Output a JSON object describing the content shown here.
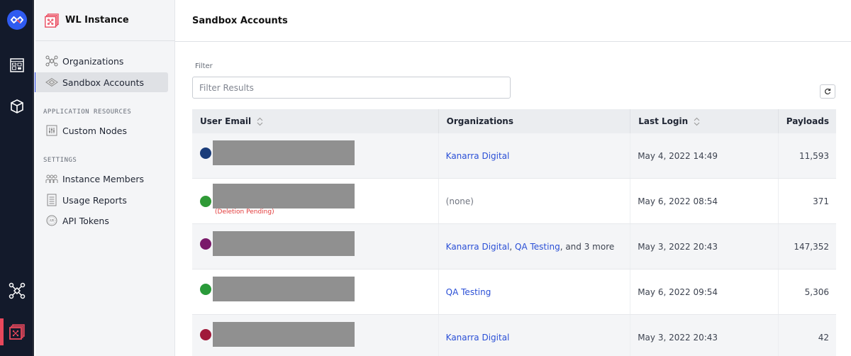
{
  "rail": {
    "items": [
      {
        "name": "logo",
        "icon": "infinity-icon"
      },
      {
        "name": "dashboard",
        "icon": "dashboard-icon"
      },
      {
        "name": "packages",
        "icon": "cube-icon"
      },
      {
        "name": "network",
        "icon": "network-nodes-icon"
      },
      {
        "name": "instance",
        "icon": "instance-stack-icon",
        "active": true
      }
    ]
  },
  "sidebar": {
    "title": "WL Instance",
    "items": [
      {
        "label": "Organizations",
        "icon": "organizations-icon"
      },
      {
        "label": "Sandbox Accounts",
        "icon": "sandbox-icon",
        "active": true
      }
    ],
    "sections": [
      {
        "title": "APPLICATION RESOURCES",
        "items": [
          {
            "label": "Custom Nodes",
            "icon": "sliders-icon"
          }
        ]
      },
      {
        "title": "SETTINGS",
        "items": [
          {
            "label": "Instance Members",
            "icon": "members-icon"
          },
          {
            "label": "Usage Reports",
            "icon": "report-icon"
          },
          {
            "label": "API Tokens",
            "icon": "api-token-icon"
          }
        ]
      }
    ]
  },
  "main": {
    "title": "Sandbox Accounts",
    "filter": {
      "label": "Filter",
      "placeholder": "Filter Results",
      "value": ""
    },
    "refresh_icon": "refresh-icon",
    "table": {
      "columns": [
        "User Email",
        "Organizations",
        "Last Login",
        "Payloads"
      ],
      "rows": [
        {
          "email": "[redacted]",
          "status": "",
          "orgs": [
            {
              "text": "Kanarra Digital",
              "link": true
            }
          ],
          "last_login": "May 4, 2022 14:49",
          "payloads": "11,593",
          "avatar": "#1b3d7a"
        },
        {
          "email": "[redacted]",
          "status": "(Deletion Pending)",
          "orgs": [
            {
              "text": "(none)",
              "link": false
            }
          ],
          "last_login": "May 6, 2022 08:54",
          "payloads": "371",
          "avatar": "#2f9a36"
        },
        {
          "email": "[redacted]",
          "status": "",
          "orgs": [
            {
              "text": "Kanarra Digital",
              "link": true
            },
            {
              "text": ", ",
              "link": false
            },
            {
              "text": "QA Testing",
              "link": true
            },
            {
              "text": ", and 3 more",
              "link": false
            }
          ],
          "last_login": "May 3, 2022 20:43",
          "payloads": "147,352",
          "avatar": "#7a1a6a"
        },
        {
          "email": "[redacted]",
          "status": "",
          "orgs": [
            {
              "text": "QA Testing",
              "link": true
            }
          ],
          "last_login": "May 6, 2022 09:54",
          "payloads": "5,306",
          "avatar": "#2a9a3a"
        },
        {
          "email": "[redacted]",
          "status": "",
          "orgs": [
            {
              "text": "Kanarra Digital",
              "link": true
            }
          ],
          "last_login": "May 3, 2022 20:43",
          "payloads": "42",
          "avatar": "#a01a3a"
        }
      ]
    }
  },
  "colors": {
    "accent": "#2f4cf0",
    "link": "#2a4fd6",
    "danger": "#e23a3a",
    "rail": "#131a2b",
    "brand_red": "#e8485c"
  }
}
